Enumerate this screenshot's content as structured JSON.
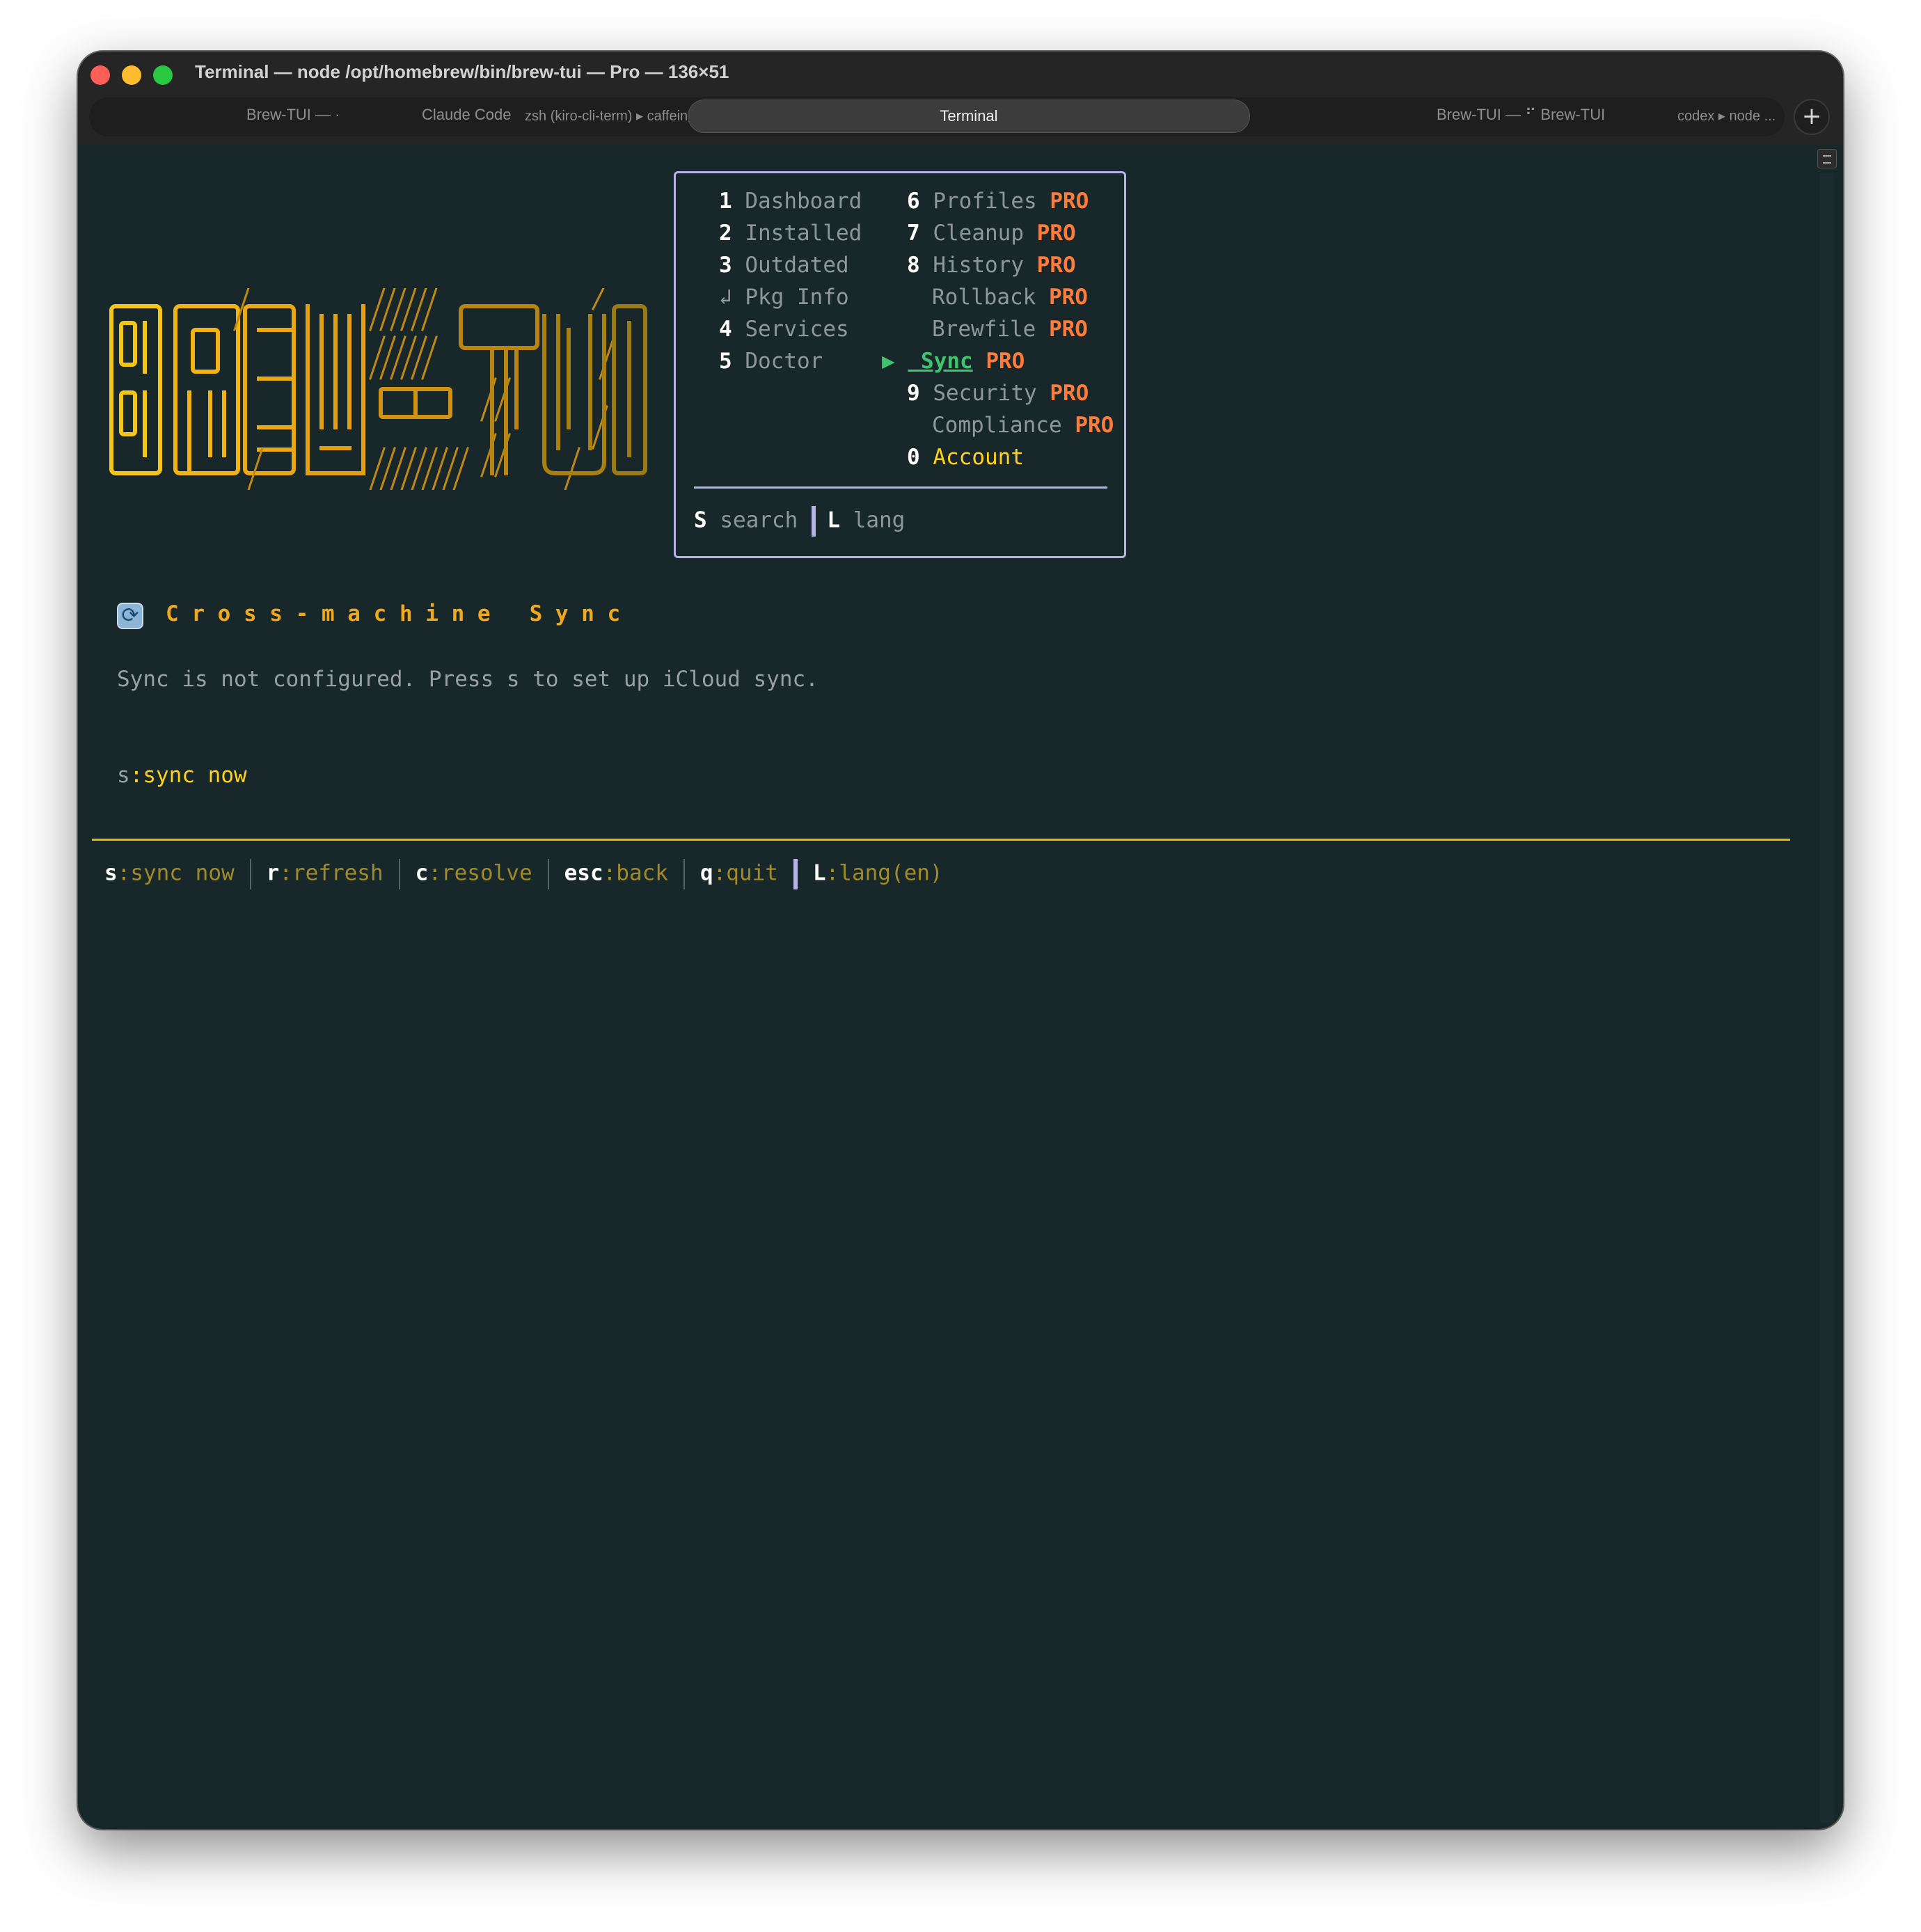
{
  "window": {
    "title": "Terminal — node /opt/homebrew/bin/brew-tui — Pro — 136×51",
    "tabs": [
      {
        "label": "Brew-TUI — ·"
      },
      {
        "label": "Claude Code"
      },
      {
        "label": "zsh (kiro-cli-term) ▸ caffeinate ..."
      },
      {
        "label": "Terminal"
      },
      {
        "label": "Brew-TUI — ⠋ Brew-TUI"
      },
      {
        "label": "codex ▸ node ..."
      }
    ],
    "new_tab_label": "+"
  },
  "logo": {
    "text": "BREW-TUI",
    "colors": {
      "primary": "#f5c518",
      "secondary": "#e6a612",
      "dim": "#9a7a12"
    }
  },
  "menu": {
    "left": [
      {
        "key": "1",
        "label": "Dashboard"
      },
      {
        "key": "2",
        "label": "Installed"
      },
      {
        "key": "3",
        "label": "Outdated"
      },
      {
        "key": "↲",
        "label": "Pkg Info"
      },
      {
        "key": "4",
        "label": "Services"
      },
      {
        "key": "5",
        "label": "Doctor"
      }
    ],
    "right": [
      {
        "key": "6",
        "label": "Profiles",
        "badge": "PRO"
      },
      {
        "key": "7",
        "label": "Cleanup",
        "badge": "PRO"
      },
      {
        "key": "8",
        "label": "History",
        "badge": "PRO"
      },
      {
        "key": "",
        "label": "Rollback",
        "badge": "PRO"
      },
      {
        "key": "",
        "label": "Brewfile",
        "badge": "PRO"
      },
      {
        "key": "▶",
        "label": " Sync",
        "badge": "PRO"
      },
      {
        "key": "9",
        "label": "Security",
        "badge": "PRO"
      },
      {
        "key": "",
        "label": "Compliance",
        "badge": "PRO"
      },
      {
        "key": "0",
        "label": "Account",
        "badge": ""
      }
    ],
    "footer": {
      "search_key": "S",
      "search_label": "search",
      "lang_key": "L",
      "lang_label": "lang"
    }
  },
  "section": {
    "icon": "refresh-icon",
    "title": "C r o s s - m a c h i n e   S y n c",
    "message": "Sync is not configured. Press s to set up iCloud sync.",
    "hint_key": "s",
    "hint_label": ":sync now"
  },
  "statusbar": [
    {
      "key": "s",
      "label": ":sync now"
    },
    {
      "key": "r",
      "label": ":refresh"
    },
    {
      "key": "c",
      "label": ":resolve"
    },
    {
      "key": "esc",
      "label": ":back"
    },
    {
      "key": "q",
      "label": ":quit"
    },
    {
      "key": "L",
      "label": ":lang(en)"
    }
  ]
}
